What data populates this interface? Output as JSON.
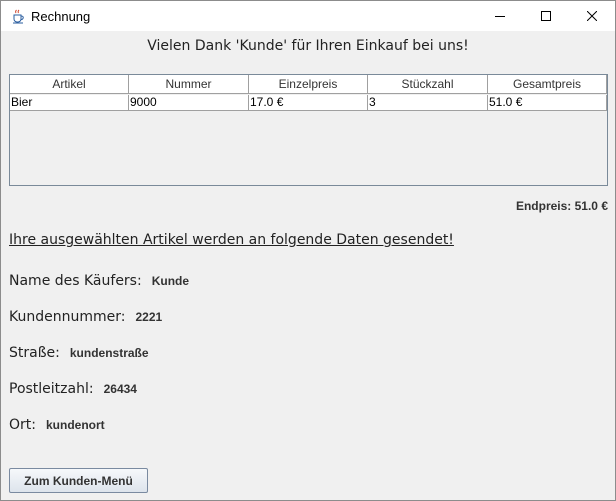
{
  "window": {
    "title": "Rechnung"
  },
  "header": {
    "thanks": "Vielen Dank 'Kunde' für Ihren Einkauf bei uns!"
  },
  "table": {
    "columns": [
      "Artikel",
      "Nummer",
      "Einzelpreis",
      "Stückzahl",
      "Gesamtpreis"
    ],
    "rows": [
      [
        "Bier",
        "9000",
        "17.0 €",
        "3",
        "51.0 €"
      ]
    ]
  },
  "summary": {
    "endprice": "Endpreis: 51.0 €"
  },
  "info": {
    "send_notice": "Ihre ausgewählten Artikel werden an folgende Daten gesendet!"
  },
  "customer": {
    "name_label": "Name des Käufers:",
    "name": "Kunde",
    "number_label": "Kundennummer:",
    "number": "2221",
    "street_label": "Straße:",
    "street": "kundenstraße",
    "zip_label": "Postleitzahl:",
    "zip": "26434",
    "city_label": "Ort:",
    "city": "kundenort"
  },
  "actions": {
    "menu_button": "Zum Kunden-Menü"
  },
  "icons": {
    "app": "java-cup-icon",
    "minimize": "minimize-icon",
    "maximize": "maximize-icon",
    "close": "close-icon"
  }
}
